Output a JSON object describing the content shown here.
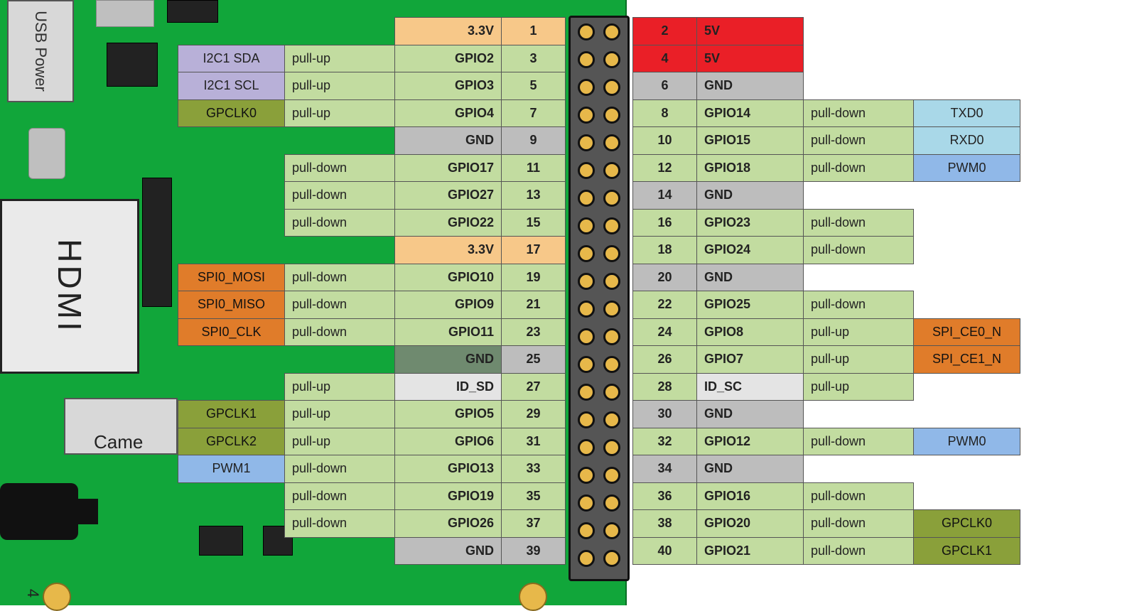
{
  "board": {
    "usb_label": "USB Power",
    "hdmi_label": "HDMI",
    "camera_label": "Came",
    "page_number": "4"
  },
  "left_pins": [
    {
      "alt": "",
      "alt_cls": "",
      "pull": "",
      "gpio": "3.3V",
      "gpio_cls": "bg-orange",
      "num": "1",
      "num_cls": "bg-orange"
    },
    {
      "alt": "I2C1 SDA",
      "alt_cls": "bg-i2c",
      "pull": "pull-up",
      "gpio": "GPIO2",
      "gpio_cls": "bg-green",
      "num": "3",
      "num_cls": "bg-green"
    },
    {
      "alt": "I2C1 SCL",
      "alt_cls": "bg-i2c",
      "pull": "pull-up",
      "gpio": "GPIO3",
      "gpio_cls": "bg-green",
      "num": "5",
      "num_cls": "bg-green"
    },
    {
      "alt": "GPCLK0",
      "alt_cls": "bg-olive",
      "pull": "pull-up",
      "gpio": "GPIO4",
      "gpio_cls": "bg-green",
      "num": "7",
      "num_cls": "bg-green"
    },
    {
      "alt": "",
      "alt_cls": "",
      "pull": "",
      "gpio": "GND",
      "gpio_cls": "bg-grey",
      "num": "9",
      "num_cls": "bg-grey"
    },
    {
      "alt": "",
      "alt_cls": "",
      "pull": "pull-down",
      "gpio": "GPIO17",
      "gpio_cls": "bg-green",
      "num": "11",
      "num_cls": "bg-green"
    },
    {
      "alt": "",
      "alt_cls": "",
      "pull": "pull-down",
      "gpio": "GPIO27",
      "gpio_cls": "bg-green",
      "num": "13",
      "num_cls": "bg-green"
    },
    {
      "alt": "",
      "alt_cls": "",
      "pull": "pull-down",
      "gpio": "GPIO22",
      "gpio_cls": "bg-green",
      "num": "15",
      "num_cls": "bg-green"
    },
    {
      "alt": "",
      "alt_cls": "",
      "pull": "",
      "gpio": "3.3V",
      "gpio_cls": "bg-orange",
      "num": "17",
      "num_cls": "bg-orange"
    },
    {
      "alt": "SPI0_MOSI",
      "alt_cls": "bg-spi",
      "pull": "pull-down",
      "gpio": "GPIO10",
      "gpio_cls": "bg-green",
      "num": "19",
      "num_cls": "bg-green"
    },
    {
      "alt": "SPI0_MISO",
      "alt_cls": "bg-spi",
      "pull": "pull-down",
      "gpio": "GPIO9",
      "gpio_cls": "bg-green",
      "num": "21",
      "num_cls": "bg-green"
    },
    {
      "alt": "SPI0_CLK",
      "alt_cls": "bg-spi",
      "pull": "pull-down",
      "gpio": "GPIO11",
      "gpio_cls": "bg-green",
      "num": "23",
      "num_cls": "bg-green"
    },
    {
      "alt": "",
      "alt_cls": "",
      "pull": "",
      "gpio": "GND",
      "gpio_cls": "bg-dgrey",
      "num": "25",
      "num_cls": "bg-grey",
      "pull_cls": "bg-dgrey"
    },
    {
      "alt": "",
      "alt_cls": "",
      "pull": "pull-up",
      "gpio": "ID_SD",
      "gpio_cls": "bg-lgrey",
      "num": "27",
      "num_cls": "bg-green"
    },
    {
      "alt": "GPCLK1",
      "alt_cls": "bg-olive",
      "pull": "pull-up",
      "gpio": "GPIO5",
      "gpio_cls": "bg-green",
      "num": "29",
      "num_cls": "bg-green"
    },
    {
      "alt": "GPCLK2",
      "alt_cls": "bg-olive",
      "pull": "pull-up",
      "gpio": "GPIO6",
      "gpio_cls": "bg-green",
      "num": "31",
      "num_cls": "bg-green"
    },
    {
      "alt": "PWM1",
      "alt_cls": "bg-pwm",
      "pull": "pull-down",
      "gpio": "GPIO13",
      "gpio_cls": "bg-green",
      "num": "33",
      "num_cls": "bg-green"
    },
    {
      "alt": "",
      "alt_cls": "",
      "pull": "pull-down",
      "gpio": "GPIO19",
      "gpio_cls": "bg-green",
      "num": "35",
      "num_cls": "bg-green"
    },
    {
      "alt": "",
      "alt_cls": "",
      "pull": "pull-down",
      "gpio": "GPIO26",
      "gpio_cls": "bg-green",
      "num": "37",
      "num_cls": "bg-green"
    },
    {
      "alt": "",
      "alt_cls": "",
      "pull": "",
      "gpio": "GND",
      "gpio_cls": "bg-grey",
      "num": "39",
      "num_cls": "bg-grey"
    }
  ],
  "right_pins": [
    {
      "num": "2",
      "num_cls": "bg-red",
      "gpio": "5V",
      "gpio_cls": "bg-red",
      "pull": "",
      "alt": "",
      "alt_cls": ""
    },
    {
      "num": "4",
      "num_cls": "bg-red",
      "gpio": "5V",
      "gpio_cls": "bg-red",
      "pull": "",
      "alt": "",
      "alt_cls": ""
    },
    {
      "num": "6",
      "num_cls": "bg-grey",
      "gpio": "GND",
      "gpio_cls": "bg-grey",
      "pull": "",
      "alt": "",
      "alt_cls": ""
    },
    {
      "num": "8",
      "num_cls": "bg-green",
      "gpio": "GPIO14",
      "gpio_cls": "bg-green",
      "pull": "pull-down",
      "alt": "TXD0",
      "alt_cls": "bg-uart"
    },
    {
      "num": "10",
      "num_cls": "bg-green",
      "gpio": "GPIO15",
      "gpio_cls": "bg-green",
      "pull": "pull-down",
      "alt": "RXD0",
      "alt_cls": "bg-uart"
    },
    {
      "num": "12",
      "num_cls": "bg-green",
      "gpio": "GPIO18",
      "gpio_cls": "bg-green",
      "pull": "pull-down",
      "alt": "PWM0",
      "alt_cls": "bg-pwm"
    },
    {
      "num": "14",
      "num_cls": "bg-grey",
      "gpio": "GND",
      "gpio_cls": "bg-grey",
      "pull": "",
      "alt": "",
      "alt_cls": ""
    },
    {
      "num": "16",
      "num_cls": "bg-green",
      "gpio": "GPIO23",
      "gpio_cls": "bg-green",
      "pull": "pull-down",
      "alt": "",
      "alt_cls": ""
    },
    {
      "num": "18",
      "num_cls": "bg-green",
      "gpio": "GPIO24",
      "gpio_cls": "bg-green",
      "pull": "pull-down",
      "alt": "",
      "alt_cls": ""
    },
    {
      "num": "20",
      "num_cls": "bg-grey",
      "gpio": "GND",
      "gpio_cls": "bg-grey",
      "pull": "",
      "alt": "",
      "alt_cls": ""
    },
    {
      "num": "22",
      "num_cls": "bg-green",
      "gpio": "GPIO25",
      "gpio_cls": "bg-green",
      "pull": "pull-down",
      "alt": "",
      "alt_cls": ""
    },
    {
      "num": "24",
      "num_cls": "bg-green",
      "gpio": "GPIO8",
      "gpio_cls": "bg-green",
      "pull": "pull-up",
      "alt": "SPI_CE0_N",
      "alt_cls": "bg-spi"
    },
    {
      "num": "26",
      "num_cls": "bg-green",
      "gpio": "GPIO7",
      "gpio_cls": "bg-green",
      "pull": "pull-up",
      "alt": "SPI_CE1_N",
      "alt_cls": "bg-spi"
    },
    {
      "num": "28",
      "num_cls": "bg-green",
      "gpio": "ID_SC",
      "gpio_cls": "bg-lgrey",
      "pull": "pull-up",
      "alt": "",
      "alt_cls": ""
    },
    {
      "num": "30",
      "num_cls": "bg-grey",
      "gpio": "GND",
      "gpio_cls": "bg-grey",
      "pull": "",
      "alt": "",
      "alt_cls": ""
    },
    {
      "num": "32",
      "num_cls": "bg-green",
      "gpio": "GPIO12",
      "gpio_cls": "bg-green",
      "pull": "pull-down",
      "alt": "PWM0",
      "alt_cls": "bg-pwm"
    },
    {
      "num": "34",
      "num_cls": "bg-grey",
      "gpio": "GND",
      "gpio_cls": "bg-grey",
      "pull": "",
      "alt": "",
      "alt_cls": ""
    },
    {
      "num": "36",
      "num_cls": "bg-green",
      "gpio": "GPIO16",
      "gpio_cls": "bg-green",
      "pull": "pull-down",
      "alt": "",
      "alt_cls": ""
    },
    {
      "num": "38",
      "num_cls": "bg-green",
      "gpio": "GPIO20",
      "gpio_cls": "bg-green",
      "pull": "pull-down",
      "alt": "GPCLK0",
      "alt_cls": "bg-olive"
    },
    {
      "num": "40",
      "num_cls": "bg-green",
      "gpio": "GPIO21",
      "gpio_cls": "bg-green",
      "pull": "pull-down",
      "alt": "GPCLK1",
      "alt_cls": "bg-olive"
    }
  ]
}
